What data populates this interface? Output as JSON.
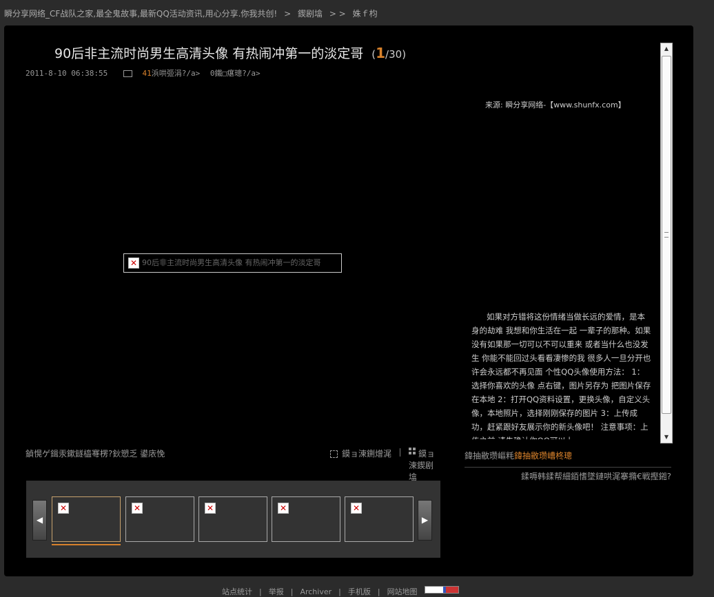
{
  "breadcrumb": {
    "site": "瞬分享网络_CF战队之家,最全鬼故事,最新QQ活动资讯,用心分享.你我共创!",
    "sep1": ">",
    "section": "鍥剧墖",
    "sep2": "> >",
    "current": "姝ｆ枃"
  },
  "title": {
    "text": "90后非主流时尚男生高清头像 有热闹冲第一的淡定哥",
    "current_index": "1",
    "total": "/30)",
    "open_paren": "("
  },
  "meta": {
    "datetime": "2011-8-10 06:38:55",
    "comment_count": "41",
    "comment_label": "浜哄弬涓?/a>",
    "view_label": "0鐵□瘎璁?/a>"
  },
  "image": {
    "alt": "90后非主流时尚男生高清头像 有热闹冲第一的淡定哥"
  },
  "source": "来源: 瞬分享网络-【www.shunfx.com】",
  "description": "如果对方错将这份情绪当做长远的爱情，是本身的劫难 我想和你生活在一起 一辈子的那种。如果没有如果那一切可以不可以重来 或者当什么也没发生 你能不能回过头看看凄惨的我 很多人一旦分开也许会永远都不再见面 个性QQ头像使用方法： 1：选择你喜欢的头像 点右键，图片另存为 把图片保存在本地 2：打开QQ资料设置，更换头像，自定义头像，本地照片，选择刚刚保存的图片 3：上传成功，赶紧跟好友展示你的新头像吧！ 注意事项：上传之前 请先确认你QQ可以上",
  "caption_left": "鍞愰ゲ鍓汞鏉鐩橀弿楞?鈥愬乏 鍙庡悗",
  "tools": {
    "fullscreen_label": "鏌ョ湅鍘熷浘",
    "grid_label": "鏌ョ湅鍥剧墖"
  },
  "right_nav": {
    "prefix": "鍏抽敭瓒嶇粍",
    "highlight": "鍏抽敭瓒嶆柊璁"
  },
  "right_link": "鍒嗕韩鍒帮細銆愭墜鏈哄浘搴撱€戦摼鎺?",
  "nav": {
    "prev": "◀",
    "next": "▶"
  },
  "thumbnails": [
    "",
    "",
    "",
    "",
    ""
  ],
  "footer": {
    "items": [
      "站点统计",
      "举报",
      "Archiver",
      "手机版",
      "网站地图"
    ],
    "sep": "|"
  },
  "colors": {
    "accent": "#d9822b",
    "background": "#000000",
    "page": "#2b2b2b"
  }
}
